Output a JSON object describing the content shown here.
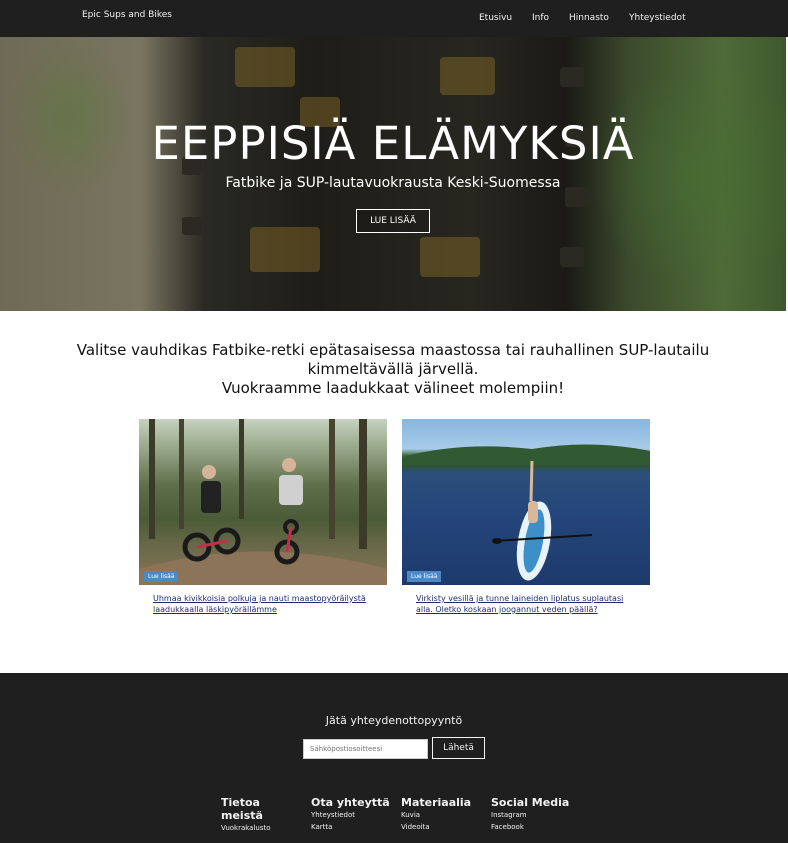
{
  "navbar": {
    "brand": "Epic Sups and Bikes",
    "links": [
      "Etusivu",
      "Info",
      "Hinnasto",
      "Yhteystiedot"
    ]
  },
  "hero": {
    "title": "EEPPISIÄ ELÄMYKSIÄ",
    "subtitle": "Fatbike ja SUP-lautavuokrausta Keski-Suomessa",
    "button": "LUE LISÄÄ"
  },
  "intro": {
    "line1": "Valitse vauhdikas Fatbike-retki epätasaisessa maastossa tai rauhallinen SUP-lautailu",
    "line2": "kimmeltävällä järvellä.",
    "line3": "Vuokraamme laadukkaat välineet molempiin!"
  },
  "cards": [
    {
      "badge": "Lue lisää",
      "text": "Uhmaa kivikkoisia polkuja ja nauti maastopyöräilystä laadukkaalla läskipyörällämme"
    },
    {
      "badge": "Lue lisää",
      "text": "Virkisty vesillä ja tunne laineiden liplatus suplautasi alla. Oletko koskaan joogannut veden päällä?"
    }
  ],
  "footer": {
    "contact_title": "Jätä yhteydenottopyyntö",
    "email_placeholder": "Sähköpostiosoitteesi",
    "send_label": "Lähetä",
    "columns": [
      {
        "title": "Tietoa meistä",
        "links": [
          "Vuokrakalusto"
        ]
      },
      {
        "title": "Ota yhteyttä",
        "links": [
          "Yhteystiedot",
          "Kartta"
        ]
      },
      {
        "title": "Materiaalia",
        "links": [
          "Kuvia",
          "Videoita"
        ]
      },
      {
        "title": "Social Media",
        "links": [
          "Instagram",
          "Facebook"
        ]
      }
    ]
  },
  "colors": {
    "nav_bg": "#1f1f1f",
    "footer_bg": "#1f1f1f",
    "badge": "#4c87c8",
    "link": "#1d2d6c"
  }
}
